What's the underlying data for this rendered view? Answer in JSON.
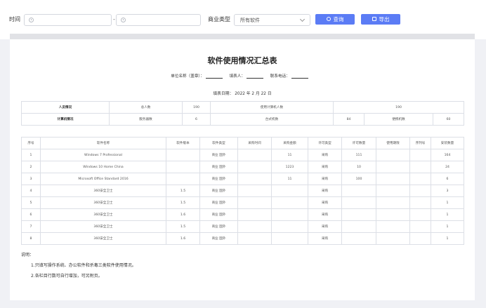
{
  "filter": {
    "time_label": "时间",
    "date_separator": "-",
    "type_label": "商业类型",
    "type_value": "所有软件",
    "search_label": "查询",
    "export_label": "导出"
  },
  "report": {
    "title": "软件使用情况汇总表",
    "unit_label": "单位名称（盖章）：",
    "filler_label": "填表人：",
    "phone_label": "联系电话：",
    "fill_date": "填表日期： 2022 年 2 月 22 日",
    "summary": {
      "row1": [
        "人员情况",
        "总人数",
        "190",
        "使用计算机人数",
        "190"
      ],
      "row2": [
        "计算机情况",
        "服务器数",
        "6",
        "台式机数",
        "84",
        "便携机数",
        "60"
      ]
    },
    "columns": [
      "序号",
      "软件名称",
      "软件版本",
      "软件类型",
      "采购时间",
      "采购金额",
      "许可类型",
      "许可数量",
      "使用期限",
      "序列号",
      "安装数量"
    ],
    "rows": [
      [
        "1",
        "Windows 7 Professional",
        "",
        "商业 国外",
        "",
        "11",
        "采购",
        "111",
        "",
        "",
        "164"
      ],
      [
        "2",
        "Windows 10 Home China",
        "",
        "商业 国外",
        "",
        "1223",
        "采购",
        "10",
        "",
        "",
        "24"
      ],
      [
        "3",
        "Microsoft Office Standard 2016",
        "",
        "商业 国外",
        "",
        "11",
        "采购",
        "100",
        "",
        "",
        "6"
      ],
      [
        "4",
        "360安全卫士",
        "1.5",
        "商业 国外",
        "",
        "",
        "采购",
        "",
        "",
        "",
        "3"
      ],
      [
        "5",
        "360安全卫士",
        "1.5",
        "商业 国外",
        "",
        "",
        "采购",
        "",
        "",
        "",
        "1"
      ],
      [
        "6",
        "360安全卫士",
        "1.6",
        "商业 国外",
        "",
        "",
        "采购",
        "",
        "",
        "",
        "1"
      ],
      [
        "7",
        "360安全卫士",
        "1.5",
        "商业 国外",
        "",
        "",
        "采购",
        "",
        "",
        "",
        "1"
      ],
      [
        "8",
        "360安全卫士",
        "1.6",
        "商业 国外",
        "",
        "",
        "采购",
        "",
        "",
        "",
        "1"
      ]
    ],
    "notes_title": "说明：",
    "notes": [
      "1.只填写操作系统、办公软件和杀毒三类软件使用情况。",
      "2.各栏目行数可自行增加，可另附页。"
    ]
  },
  "colors": {
    "accent": "#5b7cf5",
    "background": "#f0f1f5"
  },
  "icons": [
    "clock-icon",
    "chevron-down-icon",
    "search-icon",
    "export-icon"
  ]
}
